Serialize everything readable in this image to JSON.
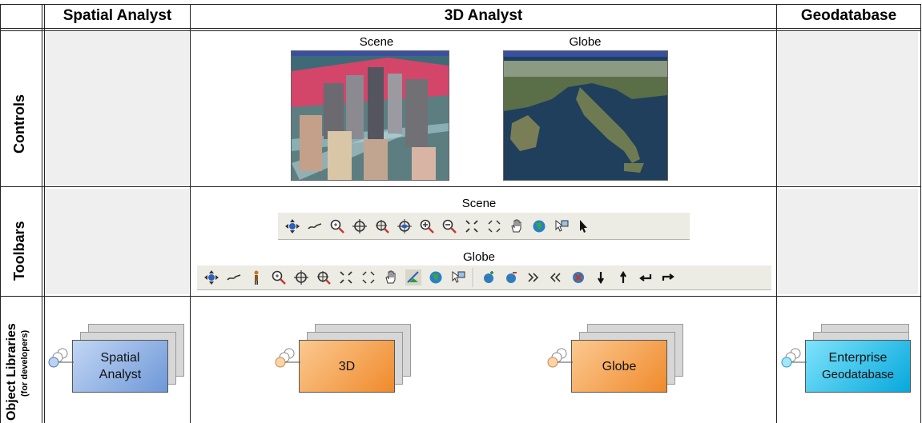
{
  "columns": {
    "spatial": "Spatial Analyst",
    "analyst3d": "3D Analyst",
    "geodatabase": "Geodatabase"
  },
  "rows": {
    "controls": "Controls",
    "toolbars": "Toolbars",
    "object_libraries": "Object Libraries",
    "object_libraries_sub": "(for developers)"
  },
  "controls": {
    "scene_caption": "Scene",
    "globe_caption": "Globe"
  },
  "toolbars": {
    "scene_caption": "Scene",
    "globe_caption": "Globe",
    "scene_icons": [
      "navigate-icon",
      "fly-icon",
      "zoom-in-out-icon",
      "target-center-icon",
      "zoom-to-target-icon",
      "set-observer-icon",
      "zoom-in-icon",
      "zoom-out-icon",
      "fixed-zoom-in-icon",
      "fixed-zoom-out-icon",
      "pan-icon",
      "full-extent-icon",
      "select-features-icon",
      "select-elements-icon"
    ],
    "globe_icons": [
      "navigate-icon",
      "fly-icon",
      "walk-icon",
      "zoom-in-out-icon",
      "target-center-icon",
      "zoom-to-target-icon",
      "fixed-zoom-in-icon",
      "fixed-zoom-out-icon",
      "pan-icon",
      "surface-icon",
      "full-extent-icon",
      "select-features-icon",
      "add-layer-icon",
      "remove-layer-icon",
      "next-view-icon",
      "previous-view-icon",
      "clear-cache-icon",
      "down-icon",
      "up-icon",
      "back-icon",
      "forward-icon"
    ]
  },
  "libraries": {
    "spatial": {
      "line1": "Spatial",
      "line2": "Analyst",
      "color": "#8ab0e6"
    },
    "three_d": {
      "line1": "3D",
      "color": "#f7a452"
    },
    "globe": {
      "line1": "Globe",
      "color": "#f7a452"
    },
    "enterprise": {
      "line1": "Enterprise",
      "line2": "Geodatabase",
      "color": "#19c4ee"
    }
  }
}
